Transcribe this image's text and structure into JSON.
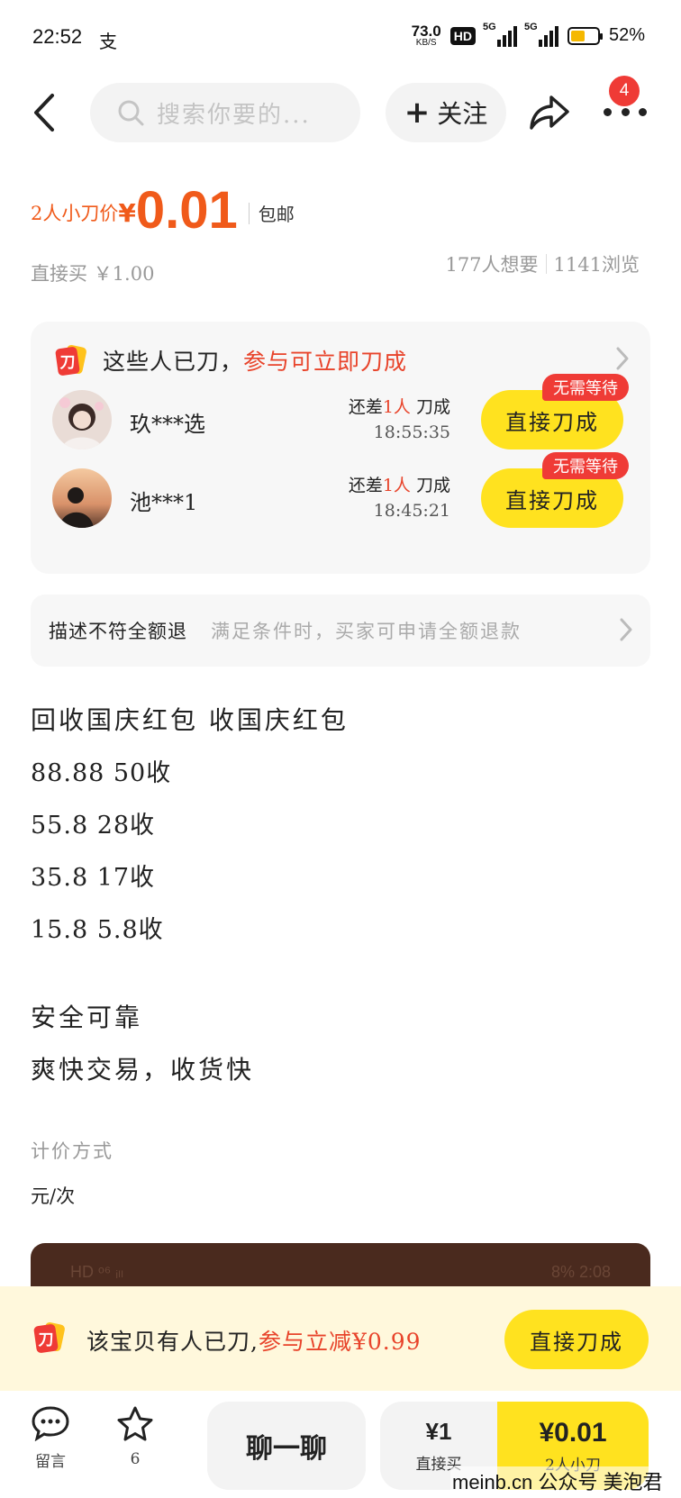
{
  "status_bar": {
    "time": "22:52",
    "app_glyph": "支",
    "net_speed": "73.0",
    "net_unit": "KB/S",
    "hd": "HD",
    "sim1": "5G",
    "sim2": "5G",
    "battery": "52%"
  },
  "header": {
    "search_placeholder": "搜索你要的...",
    "follow_label": "关注",
    "notification_count": "4"
  },
  "price": {
    "prefix": "2人小刀价",
    "currency": "¥",
    "value": "0.01",
    "shipping": "包邮",
    "direct_buy": "直接买 ￥1.00",
    "wants": "177人想要",
    "views": "1141浏览"
  },
  "bargain_card": {
    "title": "这些人已刀，",
    "title_accent": "参与可立即刀成",
    "remain_prefix": "还差",
    "remain_count": "1人",
    "remain_suffix": "刀成",
    "button": "直接刀成",
    "badge": "无需等待",
    "rows": [
      {
        "name": "玖***选",
        "countdown": "18:55:35"
      },
      {
        "name": "池***1",
        "countdown": "18:45:21"
      }
    ]
  },
  "refund": {
    "title": "描述不符全额退",
    "desc": "满足条件时，买家可申请全额退款"
  },
  "description": {
    "title": "回收国庆红包 收国庆红包",
    "lines": [
      "88.88  50收",
      "55.8  28收",
      "35.8   17收",
      "15.8   5.8收"
    ],
    "safe": "安全可靠",
    "fast": "爽快交易，收货快"
  },
  "pricing": {
    "label": "计价方式",
    "value": "元/次"
  },
  "image_peek": {
    "left": "HD ᵒ⁶ ᵢₗₗ",
    "right": "8%  2:08"
  },
  "banner": {
    "text": "该宝贝有人已刀,",
    "accent": "参与立减¥0.99",
    "button": "直接刀成"
  },
  "bottom_bar": {
    "comment_label": "留言",
    "fav_count": "6",
    "chat_label": "聊一聊",
    "direct_price": "¥1",
    "direct_label": "直接买",
    "bargain_price": "¥0.01",
    "bargain_label": "2人小刀"
  },
  "watermark": "meinb.cn 公众号 美泡君",
  "colors": {
    "accent_orange": "#f05a1a",
    "accent_red": "#e8442b",
    "button_yellow": "#ffe21f",
    "badge_red": "#ef3b36"
  }
}
